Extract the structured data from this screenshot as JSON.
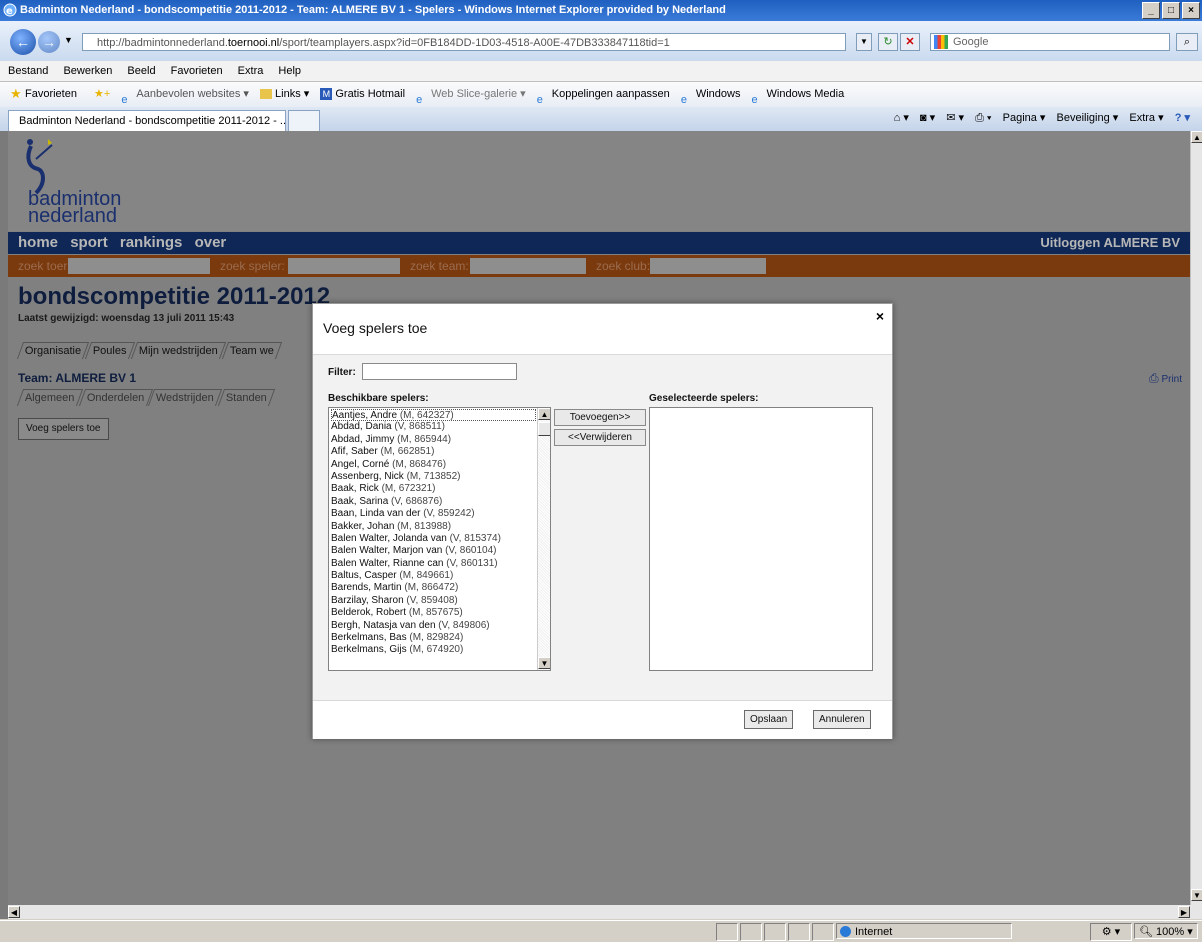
{
  "window": {
    "title": "Badminton Nederland - bondscompetitie 2011-2012 - Team: ALMERE BV 1 - Spelers - Windows Internet Explorer provided by Nederland"
  },
  "address_bar": {
    "url_prefix": "http://badmintonnederland.",
    "url_domain": "toernooi.nl",
    "url_suffix": "/sport/teamplayers.aspx?id=0FB184DD-1D03-4518-A00E-47DB333847118tid=1",
    "search_placeholder": "Google"
  },
  "menu": [
    "Bestand",
    "Bewerken",
    "Beeld",
    "Favorieten",
    "Extra",
    "Help"
  ],
  "favorites_bar": {
    "favorites_label": "Favorieten",
    "items": [
      "Aanbevolen websites ▾",
      "Links ▾",
      "Gratis Hotmail",
      "Web Slice-galerie ▾",
      "Koppelingen aanpassen",
      "Windows",
      "Windows Media"
    ]
  },
  "tab": {
    "label": "Badminton Nederland - bondscompetitie 2011-2012 - ..."
  },
  "command_bar": [
    "Pagina ▾",
    "Beveiliging ▾",
    "Extra ▾"
  ],
  "site": {
    "logo_line1": "badminton",
    "logo_line2": "nederland",
    "nav": [
      "home",
      "sport",
      "rankings",
      "over"
    ],
    "logout": "Uitloggen",
    "club": "ALMERE BV",
    "search_labels": [
      "zoek toernooi:",
      "zoek speler:",
      "zoek team:",
      "zoek club:"
    ],
    "competition_title": "bondscompetitie 2011-2012",
    "last_modified": "Laatst gewijzigd: woensdag 13 juli 2011 15:43",
    "tabs1": [
      "Organisatie",
      "Poules",
      "Mijn wedstrijden",
      "Team we"
    ],
    "team_title": "Team: ALMERE BV 1",
    "print": "Print",
    "tabs2": [
      "Algemeen",
      "Onderdelen",
      "Wedstrijden",
      "Standen"
    ],
    "add_players_button": "Voeg spelers toe"
  },
  "modal": {
    "title": "Voeg spelers toe",
    "close": "×",
    "filter_label": "Filter:",
    "filter_value": "",
    "available_label": "Beschikbare spelers:",
    "selected_label": "Geselecteerde spelers:",
    "add_button": "Toevoegen>>",
    "remove_button": "<<Verwijderen",
    "save_button": "Opslaan",
    "cancel_button": "Annuleren",
    "available_players": [
      {
        "name": "Aantjes, Andre",
        "detail": "(M, 642327)"
      },
      {
        "name": "Abdad, Dania",
        "detail": "(V, 868511)"
      },
      {
        "name": "Abdad, Jimmy",
        "detail": "(M, 865944)"
      },
      {
        "name": "Afif, Saber",
        "detail": "(M, 662851)"
      },
      {
        "name": "Angel, Corné",
        "detail": "(M, 868476)"
      },
      {
        "name": "Assenberg, Nick",
        "detail": "(M, 713852)"
      },
      {
        "name": "Baak, Rick",
        "detail": "(M, 672321)"
      },
      {
        "name": "Baak, Sarina",
        "detail": "(V, 686876)"
      },
      {
        "name": "Baan, Linda van der",
        "detail": "(V, 859242)"
      },
      {
        "name": "Bakker, Johan",
        "detail": "(M, 813988)"
      },
      {
        "name": "Balen Walter, Jolanda van",
        "detail": "(V, 815374)"
      },
      {
        "name": "Balen Walter, Marjon van",
        "detail": "(V, 860104)"
      },
      {
        "name": "Balen Walter, Rianne can",
        "detail": "(V, 860131)"
      },
      {
        "name": "Baltus, Casper",
        "detail": "(M, 849661)"
      },
      {
        "name": "Barends, Martin",
        "detail": "(M, 866472)"
      },
      {
        "name": "Barzilay, Sharon",
        "detail": "(V, 859408)"
      },
      {
        "name": "Belderok, Robert",
        "detail": "(M, 857675)"
      },
      {
        "name": "Bergh, Natasja van den",
        "detail": "(V, 849806)"
      },
      {
        "name": "Berkelmans, Bas",
        "detail": "(M, 829824)"
      },
      {
        "name": "Berkelmans, Gijs",
        "detail": "(M, 674920)"
      }
    ]
  },
  "status_bar": {
    "zone": "Internet",
    "zoom": "100%"
  },
  "colors": {
    "nav_bg": "#0f2756",
    "search_bg": "#7a3a0e",
    "title_bar": "#2a67c9"
  }
}
